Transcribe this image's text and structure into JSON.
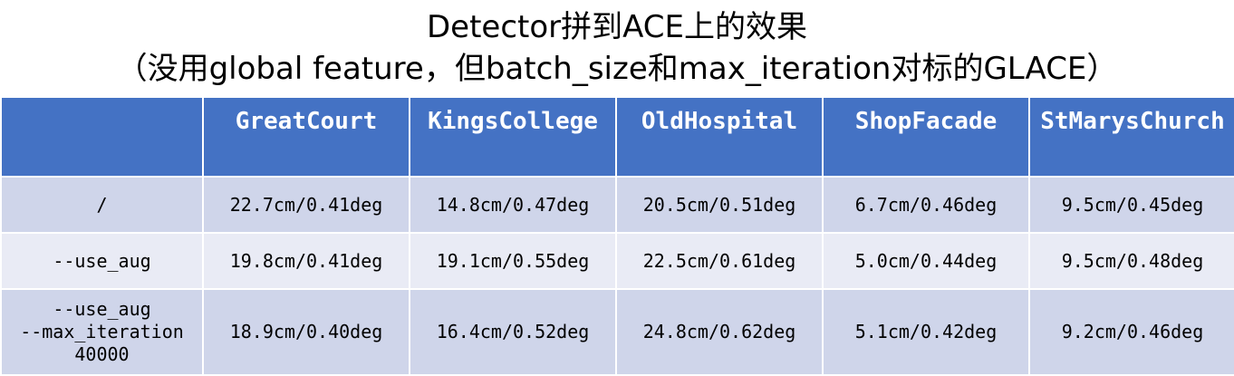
{
  "title": {
    "line1": "Detector拼到ACE上的效果",
    "line2": "（没用global feature，但batch_size和max_iteration对标的GLACE）"
  },
  "table": {
    "corner": "",
    "headers": [
      "GreatCourt",
      "KingsCollege",
      "OldHospital",
      "ShopFacade",
      "StMarysChurch"
    ],
    "rows": [
      {
        "label": "/",
        "values": [
          "22.7cm/0.41deg",
          "14.8cm/0.47deg",
          "20.5cm/0.51deg",
          "6.7cm/0.46deg",
          "9.5cm/0.45deg"
        ]
      },
      {
        "label": "--use_aug",
        "values": [
          "19.8cm/0.41deg",
          "19.1cm/0.55deg",
          "22.5cm/0.61deg",
          "5.0cm/0.44deg",
          "9.5cm/0.48deg"
        ]
      },
      {
        "label": "--use_aug\n--max_iteration\n40000",
        "values": [
          "18.9cm/0.40deg",
          "16.4cm/0.52deg",
          "24.8cm/0.62deg",
          "5.1cm/0.42deg",
          "9.2cm/0.46deg"
        ]
      }
    ]
  },
  "colors": {
    "header_bg": "#4472c4",
    "row_dark": "#cfd5ea",
    "row_light": "#e9ebf5"
  }
}
